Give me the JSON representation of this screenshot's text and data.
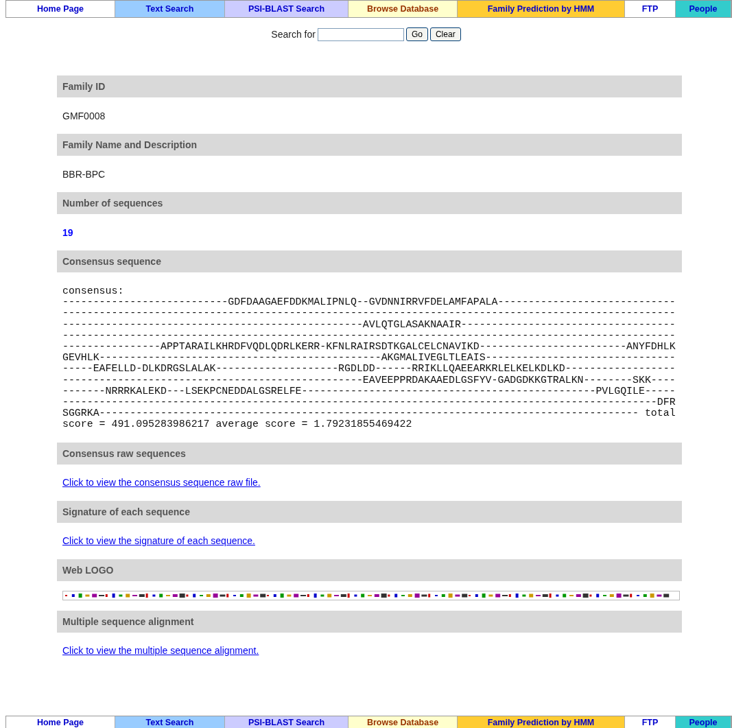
{
  "top_nav": [
    {
      "label": "Home Page",
      "color": "#ffffff",
      "kind": "plain"
    },
    {
      "label": "Text Search",
      "color": "#99ccff",
      "kind": "plain"
    },
    {
      "label": "PSI-BLAST Search",
      "color": "#ccccff",
      "kind": "plain"
    },
    {
      "label": "Browse Database",
      "color": "#ffffcc",
      "kind": "browse"
    },
    {
      "label": "Family Prediction by HMM",
      "color": "#ffcc33",
      "kind": "plain"
    },
    {
      "label": "FTP",
      "color": "#ffffff",
      "kind": "plain"
    },
    {
      "label": "People",
      "color": "#33cccc",
      "kind": "plain"
    }
  ],
  "search": {
    "label": "Search for",
    "buttons": [
      "Go",
      "Clear"
    ]
  },
  "sections": [
    {
      "heading": "Family ID",
      "kind": "text",
      "value": "GMF0008"
    },
    {
      "heading": "Family Name and Description",
      "kind": "text",
      "value": "BBR-BPC"
    },
    {
      "heading": "Number of sequences",
      "kind": "count",
      "value": "19"
    },
    {
      "heading": "Consensus sequence",
      "kind": "sequence",
      "lines": [
        "consensus:",
        "---------------------------GDFDAAGAEFDDKMALIPNLQ--GVDNNIRRVFDELAMFAPALA-----------------------------",
        "----------------------------------------------------------------------------------------------------",
        "-------------------------------------------------AVLQTGLASAKNAAIR-----------------------------------",
        "----------------------------------------------------------------------------------------------------",
        "----------------APPTARAILKHRDFVQDLQDRLKERR-KFNLRAIRSDTKGALCELCNAVIKD------------------------ANYFDHLK",
        "GEVHLK----------------------------------------------AKGMALIVEGLTLEAIS-------------------------------",
        "-----EAFELLD-DLKDRGSLALAK--------------------RGDLDD------RRIKLLQAEEARKRLELKELKDLKD------------------",
        "-------------------------------------------------EAVEEPPRDAKAAEDLGSFYV-GADGDKKGTRALKN--------SKK----",
        "-------NRRRKALEKD---LSEKPCNEDDALGSRELFE------------------------------------------------PVLGQILE-----",
        "-------------------------------------------------------------------------------------------------DFR",
        "SGGRKA---------------------------------------------------------------------------------------- total",
        "score = 491.095283986217 average score = 1.79231855469422"
      ]
    },
    {
      "heading": "Consensus raw sequences",
      "kind": "link",
      "value": "Click to view the consensus sequence raw file."
    },
    {
      "heading": "Signature of each sequence",
      "kind": "link",
      "value": "Click to view the signature of each sequence."
    },
    {
      "heading": "Web LOGO",
      "kind": "picture"
    },
    {
      "heading": "Multiple sequence alignment",
      "kind": "link",
      "value": "Click to view the multiple sequence alignment."
    }
  ],
  "bottom_nav": [
    {
      "label": "Home Page",
      "color": "#ffffff",
      "kind": "plain"
    },
    {
      "label": "Text Search",
      "color": "#99ccff",
      "kind": "plain"
    },
    {
      "label": "PSI-BLAST Search",
      "color": "#ccccff",
      "kind": "plain"
    },
    {
      "label": "Browse Database",
      "color": "#ffffcc",
      "kind": "browse"
    },
    {
      "label": "Family Prediction by HMM",
      "color": "#ffcc33",
      "kind": "plain"
    },
    {
      "label": "FTP",
      "color": "#ffffff",
      "kind": "plain"
    },
    {
      "label": "People",
      "color": "#33cccc",
      "kind": "plain"
    }
  ]
}
